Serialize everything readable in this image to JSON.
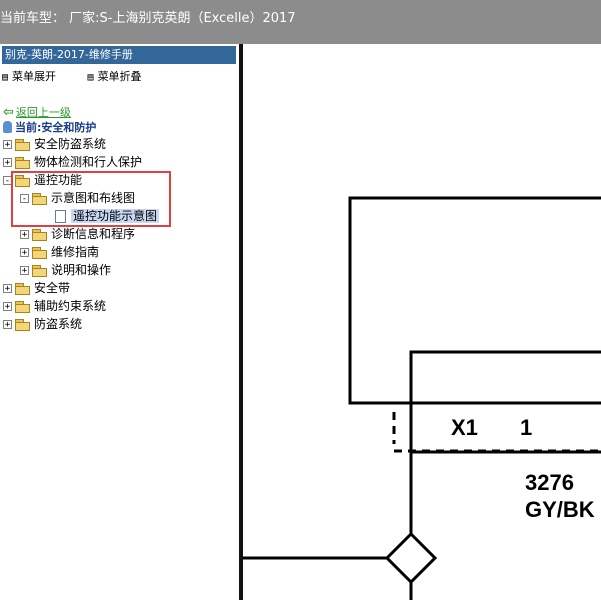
{
  "window": {
    "title": "当前车型： 厂家:S-上海别克英朗（Excelle）2017"
  },
  "sidebar": {
    "manual_title": "别克-英朗-2017-维修手册",
    "expand_label": "菜单展开",
    "collapse_label": "菜单折叠",
    "back_link": "返回上一级",
    "current_label": "当前:安全和防护",
    "tree": [
      {
        "label": "安全防盗系统",
        "toggle": "+"
      },
      {
        "label": "物体检测和行人保护",
        "toggle": "+"
      },
      {
        "label": "遥控功能",
        "toggle": "-"
      },
      {
        "label": "示意图和布线图",
        "toggle": "-"
      },
      {
        "label": "遥控功能示意图",
        "toggle": ""
      },
      {
        "label": "诊断信息和程序",
        "toggle": "+"
      },
      {
        "label": "维修指南",
        "toggle": "+"
      },
      {
        "label": "说明和操作",
        "toggle": "+"
      },
      {
        "label": "安全带",
        "toggle": "+"
      },
      {
        "label": "辅助约束系统",
        "toggle": "+"
      },
      {
        "label": "防盗系统",
        "toggle": "+"
      }
    ]
  },
  "diagram": {
    "connector": "X1",
    "pin": "1",
    "circuit_number": "3276",
    "wire_color": "GY/BK"
  }
}
